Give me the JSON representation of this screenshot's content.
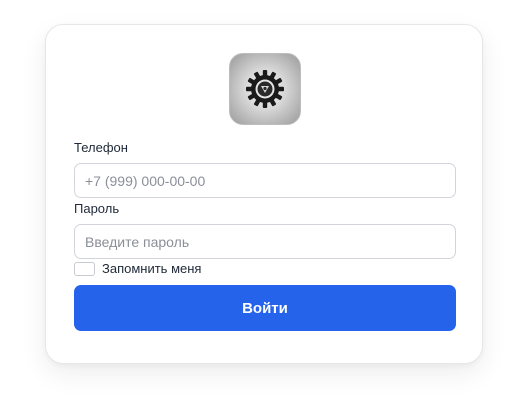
{
  "logo": {
    "icon": "gear-logo-icon"
  },
  "phone": {
    "label": "Телефон",
    "placeholder": "+7 (999) 000-00-00",
    "value": ""
  },
  "password": {
    "label": "Пароль",
    "placeholder": "Введите пароль",
    "value": ""
  },
  "remember": {
    "label": "Запомнить меня",
    "checked": false
  },
  "submit": {
    "label": "Войти"
  },
  "colors": {
    "accent": "#2563eb",
    "border": "#d1d5db",
    "text": "#1f2937"
  }
}
